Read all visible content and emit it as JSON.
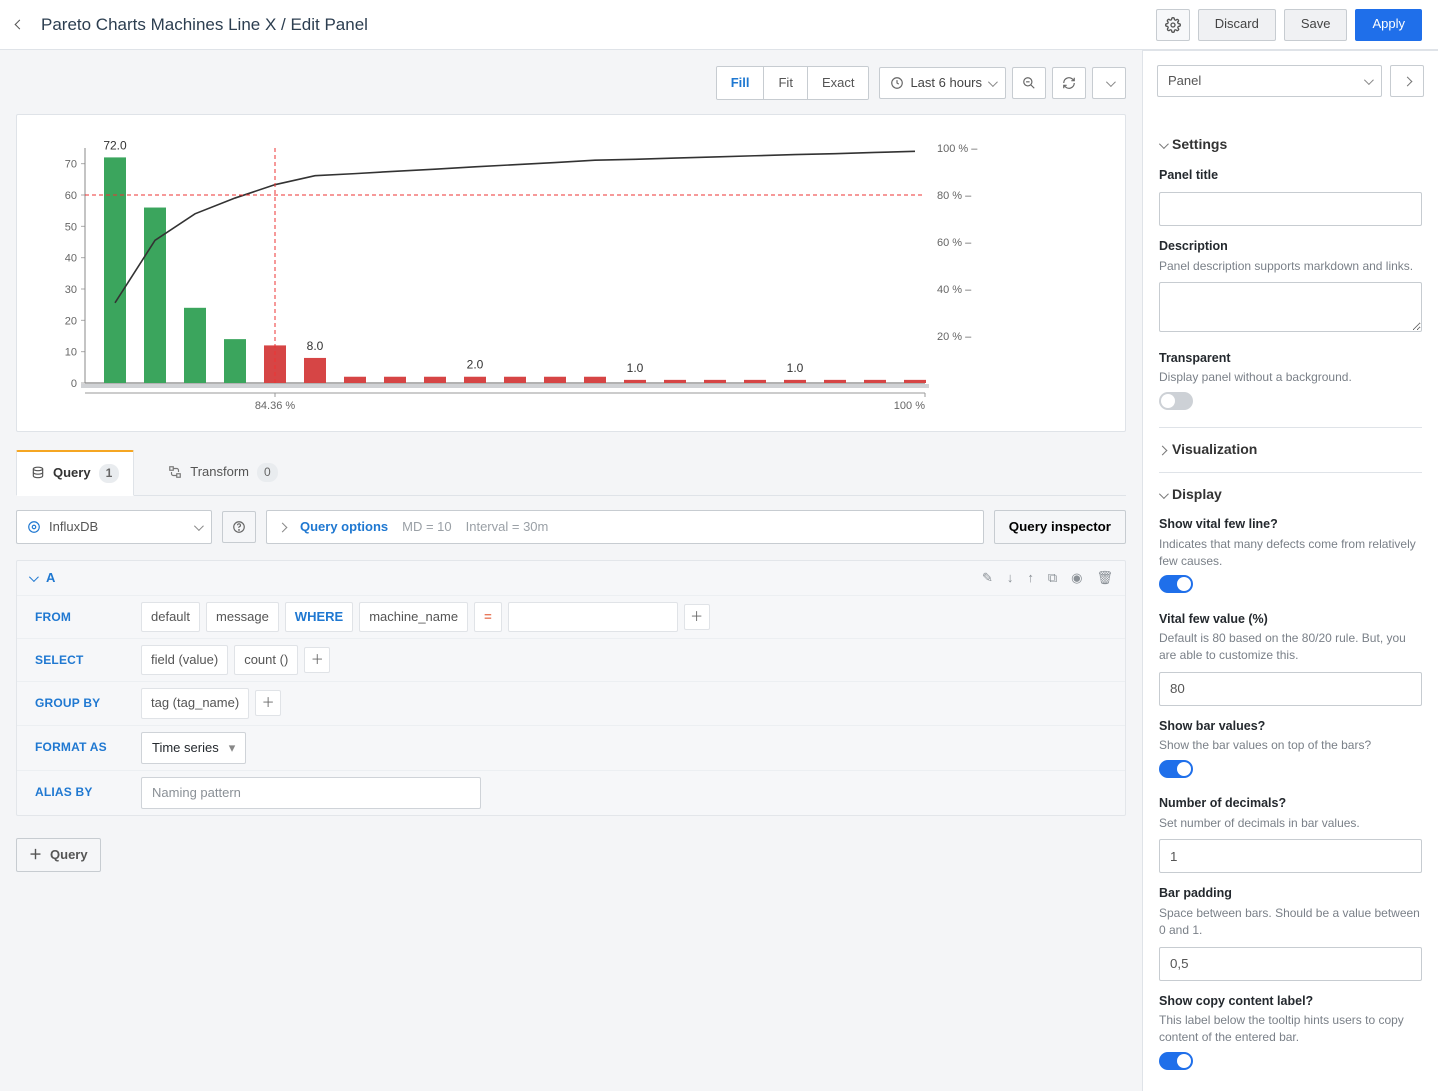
{
  "topbar": {
    "title": "Pareto Charts Machines Line X / Edit Panel",
    "discard": "Discard",
    "save": "Save",
    "apply": "Apply"
  },
  "toolbar": {
    "fill": "Fill",
    "fit": "Fit",
    "exact": "Exact",
    "time_label": "Last 6 hours"
  },
  "tabs": {
    "query": "Query",
    "query_badge": "1",
    "transform": "Transform",
    "transform_badge": "0"
  },
  "query": {
    "datasource": "InfluxDB",
    "options_link": "Query options",
    "md": "MD = 10",
    "interval": "Interval = 30m",
    "inspector": "Query inspector",
    "name": "A",
    "from": "FROM",
    "from_default": "default",
    "from_meas": "message",
    "where": "WHERE",
    "where_tag": "machine_name",
    "where_op": "=",
    "select": "SELECT",
    "sel_field": "field (value)",
    "sel_fn": "count ()",
    "groupby": "GROUP BY",
    "gb_tag": "tag (tag_name)",
    "formatas": "FORMAT AS",
    "format_value": "Time series",
    "aliasby": "ALIAS BY",
    "alias_ph": "Naming pattern",
    "add_query": "Query"
  },
  "side": {
    "select": "Panel",
    "settings": "Settings",
    "panel_title_label": "Panel title",
    "desc_label": "Description",
    "desc_hint": "Panel description supports markdown and links.",
    "transparent_label": "Transparent",
    "transparent_hint": "Display panel without a background.",
    "viz": "Visualization",
    "display": "Display",
    "vital_q": "Show vital few line?",
    "vital_hint": "Indicates that many defects come from relatively few causes.",
    "vital_val_q": "Vital few value (%)",
    "vital_val_hint": "Default is 80 based on the 80/20 rule. But, you are able to customize this.",
    "vital_val": "80",
    "bar_q": "Show bar values?",
    "bar_hint": "Show the bar values on top of the bars?",
    "dec_q": "Number of decimals?",
    "dec_hint": "Set number of decimals in bar values.",
    "dec_val": "1",
    "pad_q": "Bar padding",
    "pad_hint": "Space between bars. Should be a value between 0 and 1.",
    "pad_val": "0,5",
    "copy_q": "Show copy content label?",
    "copy_hint": "This label below the tooltip hints users to copy content of the entered bar."
  },
  "chart_data": {
    "type": "bar",
    "title": "",
    "xlabel": "",
    "ylabel": "",
    "ylim": [
      0,
      75
    ],
    "y_ticks": [
      0,
      10,
      20,
      30,
      40,
      50,
      60,
      70
    ],
    "y2_ticks": [
      "20 %",
      "40 %",
      "60 %",
      "80 %",
      "100 %"
    ],
    "vital_x_pct": 84.36,
    "x_labels": [
      "84.36 %",
      "100 %"
    ],
    "labels_shown": [
      {
        "i": 0,
        "text": "72.0"
      },
      {
        "i": 5,
        "text": "8.0"
      },
      {
        "i": 9,
        "text": "2.0"
      },
      {
        "i": 13,
        "text": "1.0"
      },
      {
        "i": 17,
        "text": "1.0"
      }
    ],
    "bars": [
      {
        "v": 72,
        "color": "green"
      },
      {
        "v": 56,
        "color": "green"
      },
      {
        "v": 24,
        "color": "green"
      },
      {
        "v": 14,
        "color": "green"
      },
      {
        "v": 12,
        "color": "red"
      },
      {
        "v": 8,
        "color": "red"
      },
      {
        "v": 2,
        "color": "red"
      },
      {
        "v": 2,
        "color": "red"
      },
      {
        "v": 2,
        "color": "red"
      },
      {
        "v": 2,
        "color": "red"
      },
      {
        "v": 2,
        "color": "red"
      },
      {
        "v": 2,
        "color": "red"
      },
      {
        "v": 2,
        "color": "red"
      },
      {
        "v": 1,
        "color": "red"
      },
      {
        "v": 1,
        "color": "red"
      },
      {
        "v": 1,
        "color": "red"
      },
      {
        "v": 1,
        "color": "red"
      },
      {
        "v": 1,
        "color": "red"
      },
      {
        "v": 1,
        "color": "red"
      },
      {
        "v": 1,
        "color": "red"
      },
      {
        "v": 1,
        "color": "red"
      }
    ],
    "series": [
      {
        "name": "cumulative_pct",
        "values": [
          34.1,
          60.7,
          72.0,
          78.7,
          84.4,
          88.2,
          89.1,
          90.1,
          91.0,
          92.0,
          92.9,
          93.8,
          94.8,
          95.2,
          95.7,
          96.2,
          96.7,
          97.2,
          97.6,
          98.1,
          98.6
        ]
      }
    ]
  }
}
